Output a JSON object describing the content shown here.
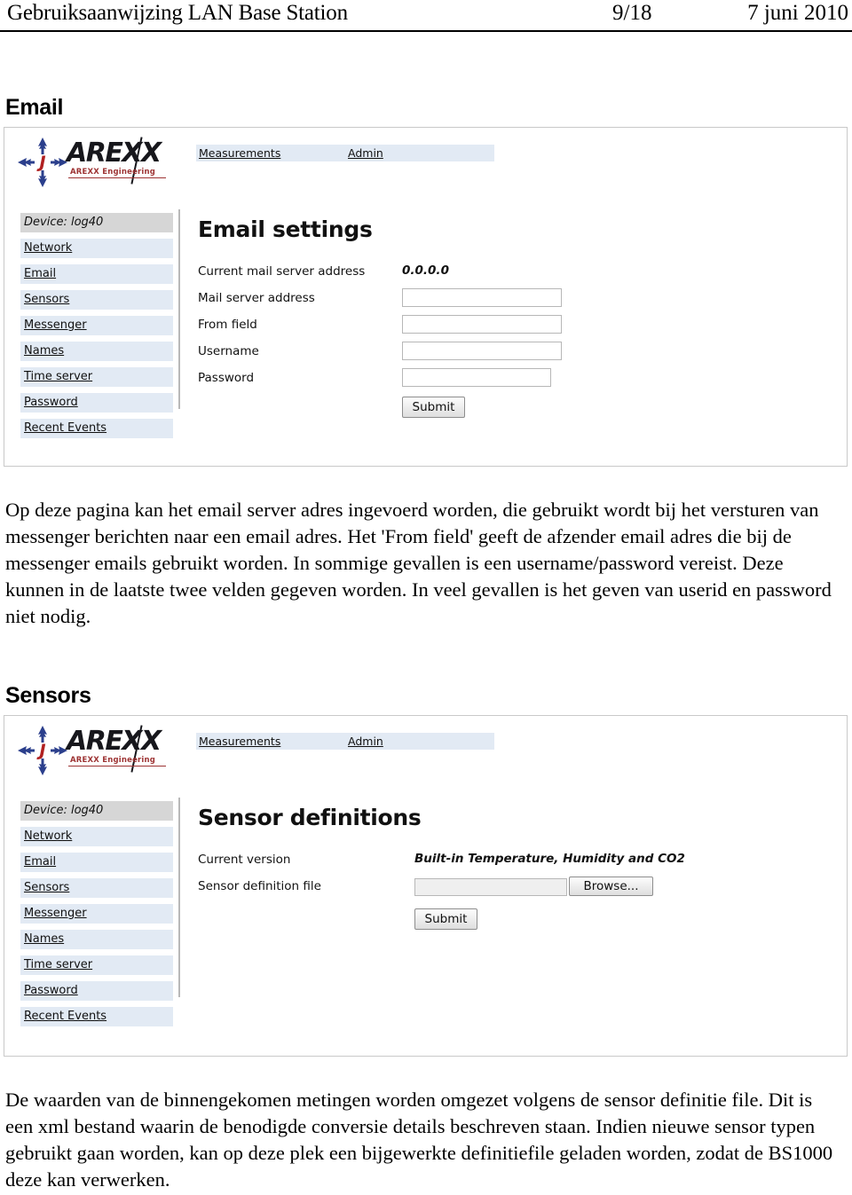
{
  "header": {
    "title": "Gebruiksaanwijzing LAN Base Station",
    "page_number": "9/18",
    "date": "7 juni 2010"
  },
  "sections": {
    "email": {
      "heading": "Email",
      "paragraph": "Op deze pagina kan het email server adres ingevoerd worden, die gebruikt wordt bij het versturen van messenger berichten naar een email adres. Het 'From field' geeft de afzender email adres die bij de messenger emails gebruikt worden. In sommige gevallen is een username/password vereist. Deze kunnen in de laatste twee velden gegeven worden. In veel gevallen is het geven van userid en password niet nodig."
    },
    "sensors": {
      "heading": "Sensors",
      "paragraph": "De waarden van de binnengekomen metingen worden omgezet volgens de sensor definitie file. Dit is een xml bestand waarin de benodigde conversie details beschreven staan. Indien nieuwe sensor typen gebruikt gaan worden, kan op deze plek een bijgewerkte definitiefile geladen worden, zodat de BS1000 deze kan verwerken."
    }
  },
  "brand": {
    "wordmark": "AREXX",
    "tagline": "AREXX Engineering",
    "emblem_letter": "J",
    "emblem_color": "#2b3f8c",
    "tagline_color": "#9d3333"
  },
  "nav_tabs": [
    {
      "label": "Measurements"
    },
    {
      "label": "Admin"
    }
  ],
  "sidebar": {
    "device": "Device: log40",
    "items": [
      {
        "label": "Network"
      },
      {
        "label": "Email"
      },
      {
        "label": "Sensors"
      },
      {
        "label": "Messenger"
      },
      {
        "label": "Names"
      },
      {
        "label": "Time server"
      },
      {
        "label": "Password"
      },
      {
        "label": "Recent Events"
      }
    ]
  },
  "email_app": {
    "title": "Email settings",
    "fields": {
      "current_mail_server_label": "Current mail server address",
      "current_mail_server_value": "0.0.0.0",
      "mail_server_label": "Mail server address",
      "mail_server_value": "",
      "from_field_label": "From field",
      "from_field_value": "",
      "username_label": "Username",
      "username_value": "",
      "password_label": "Password",
      "password_value": ""
    },
    "submit_label": "Submit"
  },
  "sensors_app": {
    "title": "Sensor definitions",
    "fields": {
      "current_version_label": "Current version",
      "current_version_value": "Built-in Temperature, Humidity and CO2",
      "definition_file_label": "Sensor definition file",
      "definition_file_value": ""
    },
    "browse_label": "Browse...",
    "submit_label": "Submit"
  },
  "colors": {
    "tab_background": "#e2eaf4",
    "device_background": "#d6d6d6",
    "frame_border": "#c9c9c9"
  }
}
